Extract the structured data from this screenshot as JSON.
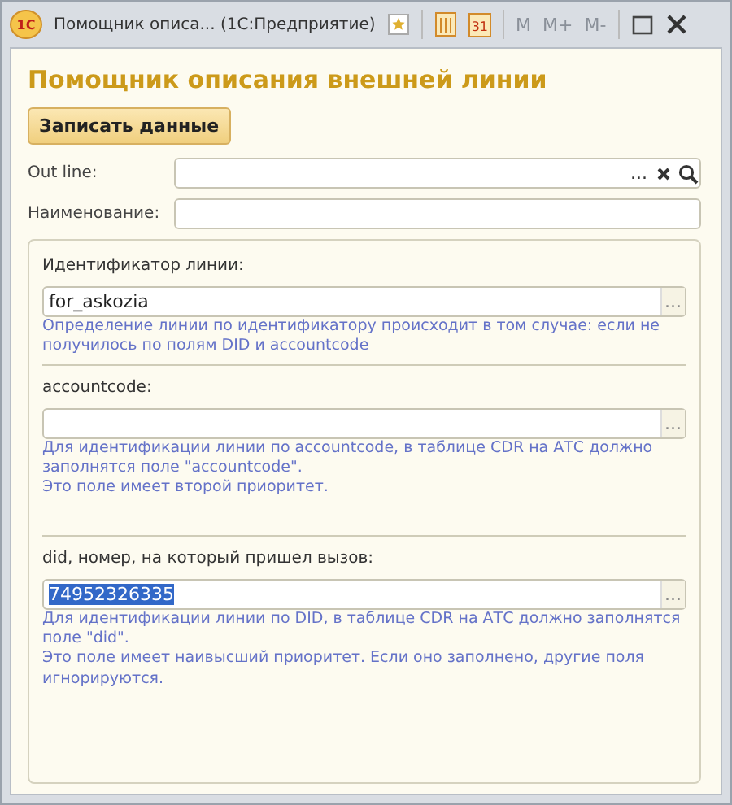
{
  "window": {
    "title": "Помощник описа... (1С:Предприятие)",
    "logo": "1С",
    "calendar_day": "31",
    "memory_buttons": [
      {
        "label": "M",
        "disabled": true
      },
      {
        "label": "M+",
        "disabled": true
      },
      {
        "label": "M-",
        "disabled": true
      }
    ]
  },
  "select_button_text": "...",
  "heading": "Помощник описания внешней линии",
  "save_button": "Записать данные",
  "fields": [
    {
      "label": "Out line:",
      "kind": "lookup"
    },
    {
      "label": "Наименование:",
      "kind": "plain"
    }
  ],
  "sections": [
    {
      "label": "Идентификатор линии:",
      "value": "for_askozia",
      "hint": [
        "Определение линии по идентификатору происходит в том случае: если не получилось по полям DID и accountcode"
      ]
    },
    {
      "label": "accountcode:",
      "hint": [
        "Для идентификации линии по accountcode, в таблице CDR на АТС должно заполнятся поле \"accountcode\".",
        "Это поле имеет второй приоритет."
      ]
    },
    {
      "label": "did, номер, на который пришел вызов:",
      "value": "74952326335",
      "value_selected": true,
      "hint": [
        "Для идентификации линии по DID, в таблице CDR на АТС должно заполнятся поле \"did\".",
        "Это поле имеет наивысший приоритет. Если оно заполнено, другие поля игнорируются."
      ]
    }
  ]
}
